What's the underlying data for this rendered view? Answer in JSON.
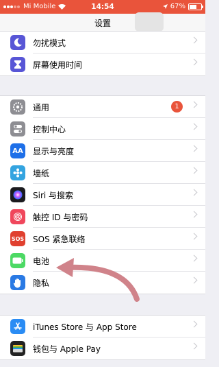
{
  "status_bar": {
    "carrier": "Mi Mobile",
    "time": "14:54",
    "battery": "67%",
    "battery_level": 0.67
  },
  "nav": {
    "title": "设置"
  },
  "group1": [
    {
      "label": "勿扰模式",
      "icon": "moon-icon",
      "color": "#5856d6"
    },
    {
      "label": "屏幕使用时间",
      "icon": "hourglass-icon",
      "color": "#5856d6"
    }
  ],
  "group2": [
    {
      "label": "通用",
      "icon": "gear-icon",
      "color": "#8e8e93",
      "badge": "1"
    },
    {
      "label": "控制中心",
      "icon": "toggles-icon",
      "color": "#8e8e93"
    },
    {
      "label": "显示与亮度",
      "icon": "text-size-icon",
      "color": "#1e6fe8",
      "glyph": "AA"
    },
    {
      "label": "墙纸",
      "icon": "flower-icon",
      "color": "#34a4e0"
    },
    {
      "label": "Siri 与搜索",
      "icon": "siri-icon",
      "color": "#1b1b1f"
    },
    {
      "label": "触控 ID 与密码",
      "icon": "fingerprint-icon",
      "color": "#f0475c"
    },
    {
      "label": "SOS 紧急联络",
      "icon": "sos-icon",
      "color": "#e0402f",
      "glyph": "SOS"
    },
    {
      "label": "电池",
      "icon": "battery-icon",
      "color": "#4cd964"
    },
    {
      "label": "隐私",
      "icon": "hand-icon",
      "color": "#2a7ae4"
    }
  ],
  "group3": [
    {
      "label": "iTunes Store 与 App Store",
      "icon": "app-store-icon",
      "color": "#2a8cf4"
    },
    {
      "label": "钱包与 Apple Pay",
      "icon": "wallet-icon",
      "color": "#222222"
    }
  ]
}
